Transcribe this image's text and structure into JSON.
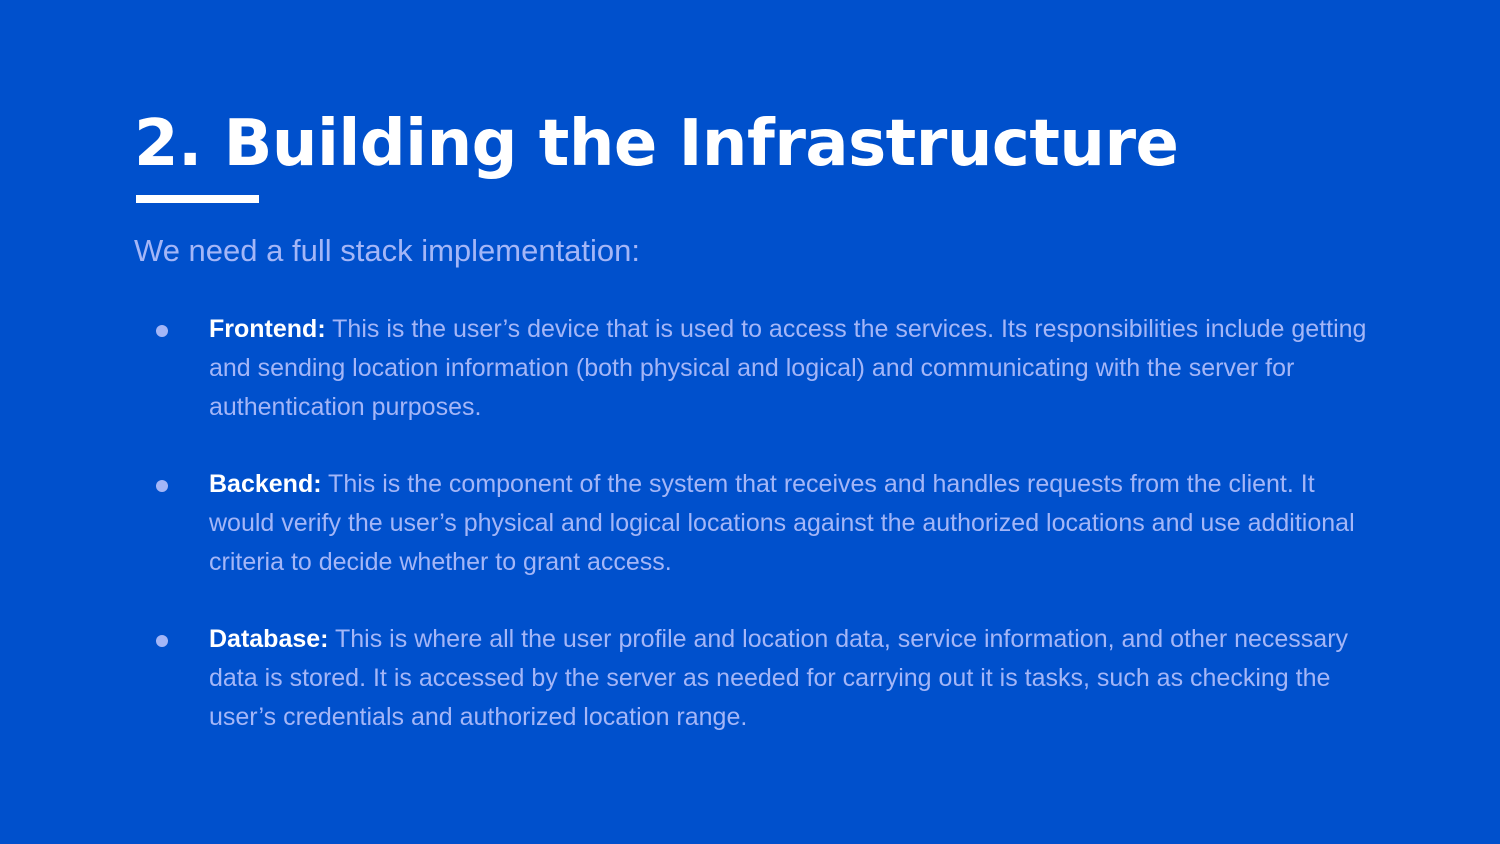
{
  "slide": {
    "title": "2. Building the Infrastructure",
    "subtitle": "We need a full stack implementation:",
    "bullets": [
      {
        "term": "Frontend:",
        "text": "This is the user’s device that is used to access the services. Its responsibilities include getting and sending location information (both physical and logical) and communicating with the server for authentication purposes."
      },
      {
        "term": "Backend:",
        "text": "This is the component of the system that receives and handles requests from the client. It would verify the user’s physical and logical locations against the authorized locations and use additional criteria to decide whether to grant access."
      },
      {
        "term": "Database:",
        "text": "This is where all the user profile and location data, service information, and other necessary data is stored. It is accessed by the server as needed for carrying out it is tasks, such as checking the user’s credentials and authorized location range."
      }
    ]
  },
  "colors": {
    "background": "#0050cc",
    "title": "#ffffff",
    "body_text": "#a4b6f7",
    "term_text": "#ffffff"
  }
}
